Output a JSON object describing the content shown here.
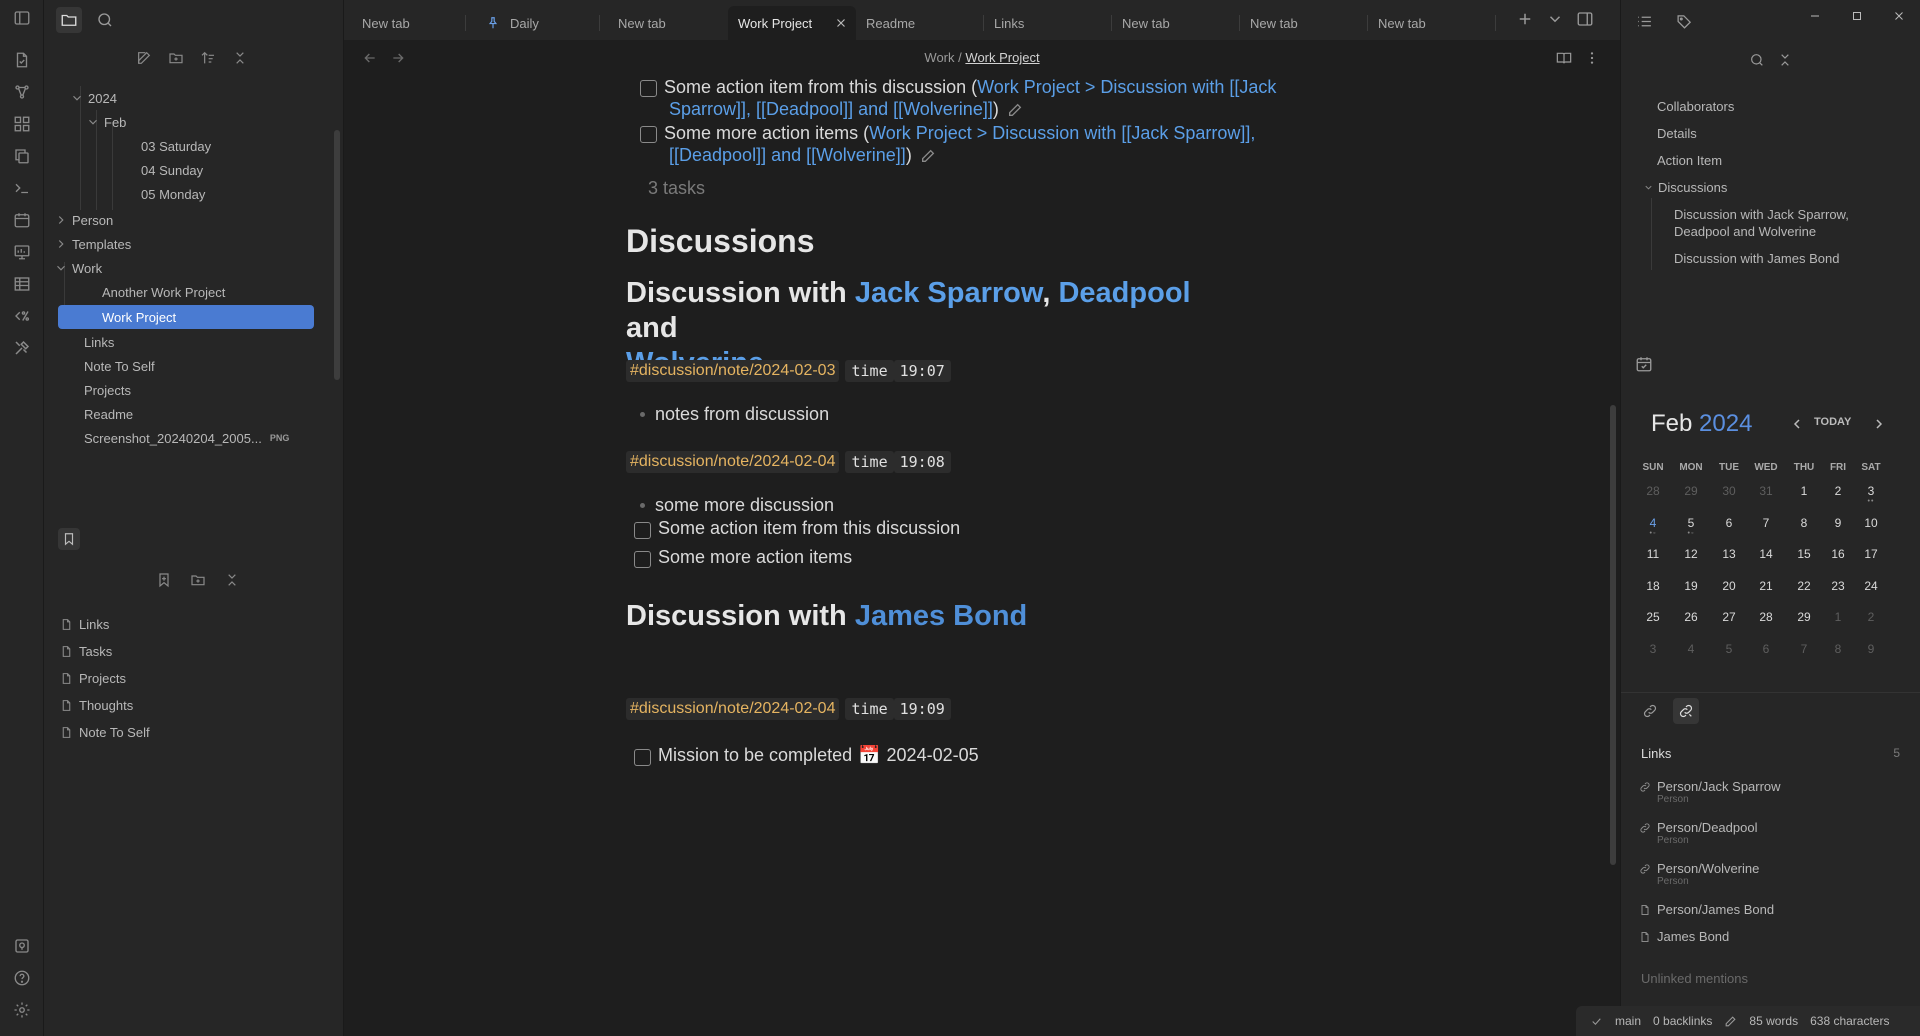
{
  "ribbon": {
    "icons": [
      "files-icon",
      "graph-icon",
      "canvas-icon",
      "copy-icon",
      "terminal-icon",
      "calendar-icon",
      "dashboard-icon",
      "table-icon",
      "percent-icon",
      "tools-icon"
    ],
    "bottom_icons": [
      "vault-icon",
      "help-icon",
      "settings-icon"
    ]
  },
  "sidebar": {
    "top_icons": [
      "folder-icon",
      "search-icon"
    ],
    "tree": [
      {
        "label": "2024",
        "level": 1,
        "chevron": "down"
      },
      {
        "label": "Feb",
        "level": 2,
        "chevron": "down"
      },
      {
        "label": "03 Saturday",
        "level": 3
      },
      {
        "label": "04 Sunday",
        "level": 3
      },
      {
        "label": "05 Monday",
        "level": 3
      },
      {
        "label": "Person",
        "level": 0,
        "chevron": "right"
      },
      {
        "label": "Templates",
        "level": 0,
        "chevron": "right"
      },
      {
        "label": "Work",
        "level": 0,
        "chevron": "down"
      },
      {
        "label": "Another Work Project",
        "level": 1
      },
      {
        "label": "Work Project",
        "level": 1,
        "selected": true
      },
      {
        "label": "Links",
        "level": 0
      },
      {
        "label": "Note To Self",
        "level": 0
      },
      {
        "label": "Projects",
        "level": 0
      },
      {
        "label": "Readme",
        "level": 0
      },
      {
        "label": "Screenshot_20240204_2005...",
        "level": 0,
        "badge": "PNG"
      }
    ],
    "bookmarks": [
      "Links",
      "Tasks",
      "Projects",
      "Thoughts",
      "Note To Self"
    ]
  },
  "tabs": [
    {
      "label": "New tab"
    },
    {
      "label": "Daily",
      "pinned": true
    },
    {
      "label": "New tab"
    },
    {
      "label": "Work Project",
      "active": true
    },
    {
      "label": "Readme"
    },
    {
      "label": "Links"
    },
    {
      "label": "New tab"
    },
    {
      "label": "New tab"
    },
    {
      "label": "New tab"
    }
  ],
  "breadcrumb": {
    "parent": "Work",
    "sep": "/",
    "current": "Work Project"
  },
  "note": {
    "task1_text": "Some action item from this discussion (",
    "task1_link_a": "Work Project > Discussion with [[Jack",
    "task1_link_b": "Sparrow]], [[Deadpool]] and [[Wolverine]]",
    "task2_text": "Some more action items (",
    "task2_link_a": "Work Project > Discussion with [[Jack Sparrow]],",
    "task2_link_b": "[[Deadpool]] and [[Wolverine]]",
    "close_paren": ")",
    "tasks_count": "3 tasks",
    "h_discussions": "Discussions",
    "h_disc1_prefix": "Discussion with ",
    "h_disc1_link1": "Jack Sparrow",
    "h_disc1_comma": ", ",
    "h_disc1_link2": "Deadpool",
    "h_disc1_and": " and",
    "h_disc1_link3": "Wolverine",
    "tag1": "#discussion/note/2024-02-03",
    "time_label": "time",
    "time1": "19:07",
    "bullet1": "notes from discussion",
    "tag2": "#discussion/note/2024-02-04",
    "time2": "19:08",
    "bullet2": "some more discussion",
    "task3": "Some action item from this discussion",
    "task4": "Some more action items",
    "h_disc2_prefix": "Discussion with ",
    "h_disc2_link": "James Bond",
    "tag3": "#discussion/note/2024-02-04",
    "time3": "19:09",
    "task5_text": "Mission to be completed",
    "task5_date_icon": "📅",
    "task5_date": "2024-02-05"
  },
  "outline": {
    "items": [
      {
        "label": "Collaborators",
        "level": 0
      },
      {
        "label": "Details",
        "level": 0
      },
      {
        "label": "Action Item",
        "level": 0
      },
      {
        "label": "Discussions",
        "level": 0,
        "chevron": "down"
      },
      {
        "label": "Discussion with Jack Sparrow, Deadpool and Wolverine",
        "level": 1
      },
      {
        "label": "Discussion with James Bond",
        "level": 1
      }
    ]
  },
  "calendar": {
    "month": "Feb",
    "year": "2024",
    "today_label": "TODAY",
    "weekdays": [
      "SUN",
      "MON",
      "TUE",
      "WED",
      "THU",
      "FRI",
      "SAT"
    ],
    "weeks": [
      [
        {
          "d": "28",
          "dim": true
        },
        {
          "d": "29",
          "dim": true
        },
        {
          "d": "30",
          "dim": true
        },
        {
          "d": "31",
          "dim": true
        },
        {
          "d": "1"
        },
        {
          "d": "2"
        },
        {
          "d": "3",
          "dots": "••"
        }
      ],
      [
        {
          "d": "4",
          "today": true,
          "dots": "•◦"
        },
        {
          "d": "5",
          "dots": "•◦"
        },
        {
          "d": "6"
        },
        {
          "d": "7"
        },
        {
          "d": "8"
        },
        {
          "d": "9"
        },
        {
          "d": "10"
        }
      ],
      [
        {
          "d": "11"
        },
        {
          "d": "12"
        },
        {
          "d": "13"
        },
        {
          "d": "14"
        },
        {
          "d": "15"
        },
        {
          "d": "16"
        },
        {
          "d": "17"
        }
      ],
      [
        {
          "d": "18"
        },
        {
          "d": "19"
        },
        {
          "d": "20"
        },
        {
          "d": "21"
        },
        {
          "d": "22"
        },
        {
          "d": "23"
        },
        {
          "d": "24"
        }
      ],
      [
        {
          "d": "25"
        },
        {
          "d": "26"
        },
        {
          "d": "27"
        },
        {
          "d": "28"
        },
        {
          "d": "29"
        },
        {
          "d": "1",
          "dim": true
        },
        {
          "d": "2",
          "dim": true
        }
      ],
      [
        {
          "d": "3",
          "dim": true
        },
        {
          "d": "4",
          "dim": true
        },
        {
          "d": "5",
          "dim": true
        },
        {
          "d": "6",
          "dim": true
        },
        {
          "d": "7",
          "dim": true
        },
        {
          "d": "8",
          "dim": true
        },
        {
          "d": "9",
          "dim": true
        }
      ]
    ]
  },
  "backlinks": {
    "header": "Links",
    "count": "5",
    "items": [
      {
        "title": "Person/Jack Sparrow",
        "sub": "Person",
        "icon": "link-icon"
      },
      {
        "title": "Person/Deadpool",
        "sub": "Person",
        "icon": "link-icon"
      },
      {
        "title": "Person/Wolverine",
        "sub": "Person",
        "icon": "link-icon"
      },
      {
        "title": "Person/James Bond",
        "icon": "file-icon"
      },
      {
        "title": "James Bond",
        "icon": "file-icon"
      }
    ],
    "unlinked": "Unlinked mentions"
  },
  "status": {
    "branch": "main",
    "backlinks": "0 backlinks",
    "words": "85 words",
    "chars": "638 characters"
  },
  "colors": {
    "accent": "#4a7bd2",
    "link": "#5b9fe8",
    "tag": "#e5b461"
  }
}
